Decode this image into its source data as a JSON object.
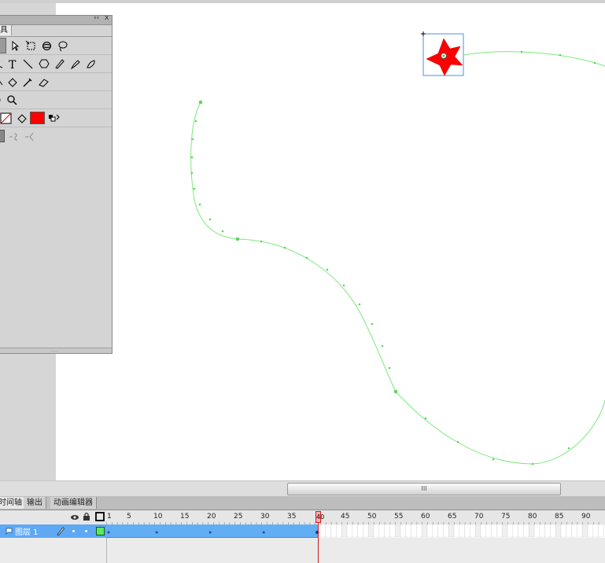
{
  "tools_panel": {
    "tab_label": "具",
    "controls": [
      "‹‹",
      "x"
    ],
    "rows": [
      [
        "arrow-icon",
        "subselect-icon",
        "free-transform-icon",
        "3d-rotation-icon",
        "lasso-icon"
      ],
      [
        "pen-icon",
        "text-icon",
        "line-icon",
        "rect-icon",
        "pencil-icon",
        "brush-icon",
        "deco-icon"
      ],
      [
        "bone-icon",
        "paint-bucket-icon",
        "eyedropper-icon",
        "eraser-icon"
      ],
      [
        "hand-icon",
        "zoom-icon"
      ],
      [
        "stroke-color-icon",
        "fill-color-icon",
        "swap-colors-icon"
      ],
      [
        "snap-icon",
        "smooth-icon",
        "straighten-icon"
      ]
    ],
    "stroke_color": "none",
    "fill_color": "#ff0000"
  },
  "scrollbar": {
    "thumb_label": "III"
  },
  "timeline": {
    "tabs": [
      {
        "label": "时间轴",
        "active": true
      },
      {
        "label": "输出",
        "active": false
      },
      {
        "label": "动画编辑器",
        "active": false
      }
    ],
    "header_icons": [
      "eye-icon",
      "lock-icon",
      "outline-icon"
    ],
    "frame_labels": [
      "1",
      "5",
      "10",
      "15",
      "20",
      "25",
      "30",
      "35",
      "40",
      "45",
      "50",
      "55",
      "60",
      "65",
      "70",
      "75",
      "80",
      "85",
      "90"
    ],
    "current_frame": "40",
    "layer": {
      "name": "图层 1"
    },
    "tween_end_frame": 40
  },
  "colors": {
    "star_fill": "#ff0000",
    "motion_path": "#7de87d",
    "selection": "#4a90e2",
    "layer_highlight": "#5ea8f4",
    "playhead": "#d21d1d"
  }
}
